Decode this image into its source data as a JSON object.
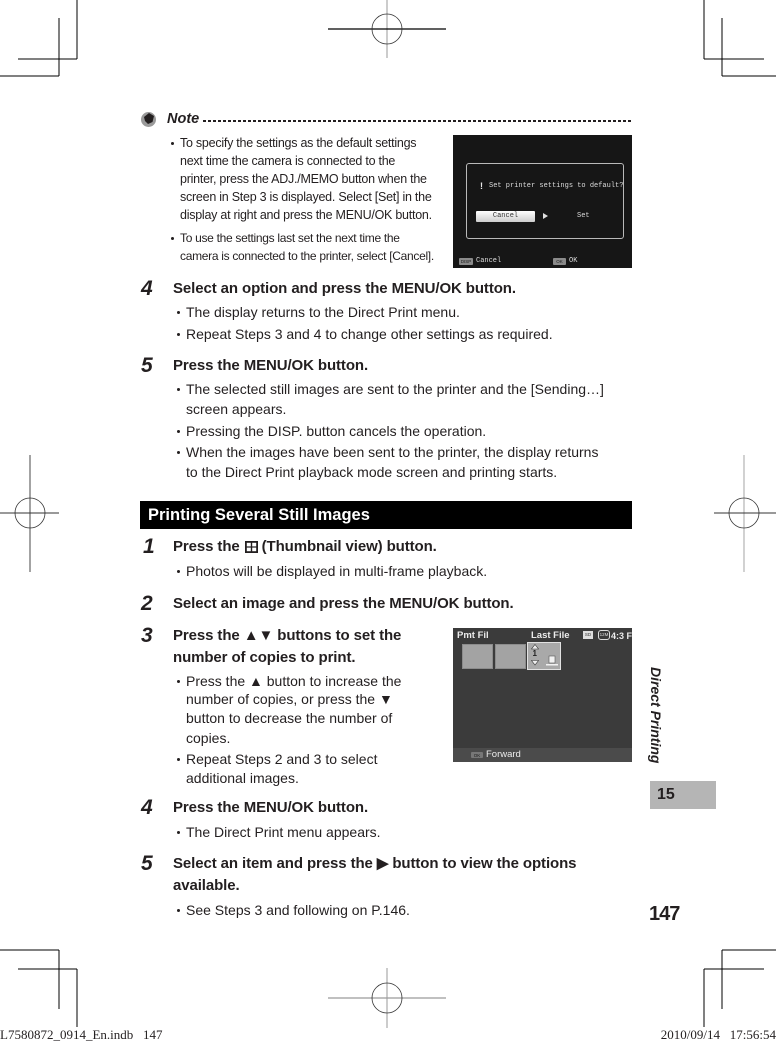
{
  "note": {
    "title": "Note",
    "icon": "note-icon",
    "bullets": [
      {
        "lines": [
          "To specify the settings as the default settings",
          "next time the camera is connected to the",
          "printer, press the ADJ./MEMO button when the",
          "screen in Step 3 is displayed. Select [Set] in the",
          "display at right and press the MENU/OK button."
        ]
      },
      {
        "lines": [
          "To use the settings last set the next time the",
          "camera is connected to the printer, select [Cancel]."
        ]
      }
    ]
  },
  "screen_default": {
    "alert": "!",
    "question": "Set printer settings to default?",
    "selected_option": "Cancel",
    "other_option": "Set",
    "footer": {
      "disp_badge": "DISP",
      "disp_label": "Cancel",
      "ok_badge": "OK",
      "ok_label": "OK"
    }
  },
  "steps_top": [
    {
      "number": "4",
      "heading": [
        "Select an option and press the MENU/OK button."
      ],
      "bullets": [
        {
          "lines": [
            "The display returns to the Direct Print menu."
          ]
        },
        {
          "lines": [
            "Repeat Steps 3 and 4 to change other settings as required."
          ]
        }
      ]
    },
    {
      "number": "5",
      "heading": [
        "Press the MENU/OK button."
      ],
      "bullets": [
        {
          "lines": [
            "The selected still images are sent to the printer and the [Sending…]",
            "screen appears."
          ]
        },
        {
          "lines": [
            "Pressing the DISP. button cancels the operation."
          ]
        },
        {
          "lines": [
            "When the images have been sent to the printer, the display returns",
            "to the Direct Print playback mode screen and printing starts."
          ]
        }
      ]
    }
  ],
  "section": {
    "title": "Printing Several Still Images"
  },
  "steps_bottom": [
    {
      "number": "1",
      "heading_before": "Press the",
      "heading_icon": "thumbnail-view-icon",
      "heading_after": "(Thumbnail view) button.",
      "bullets": [
        {
          "lines": [
            "Photos will be displayed in multi-frame playback."
          ]
        }
      ]
    },
    {
      "number": "2",
      "heading": [
        "Select an image and press the MENU/OK button."
      ]
    },
    {
      "number": "3",
      "heading": [
        "Press the ▲▼ buttons to set the",
        "number of copies to print."
      ],
      "bullets": [
        {
          "lines": [
            "Press the ▲ button to increase the",
            "number of copies, or press the ▼",
            "button to decrease the number of",
            "copies."
          ]
        },
        {
          "lines": [
            "Repeat Steps 2 and 3 to select",
            "additional images."
          ]
        }
      ]
    },
    {
      "number": "4",
      "heading": [
        "Press the MENU/OK button."
      ],
      "bullets": [
        {
          "lines": [
            "The Direct Print menu appears."
          ]
        }
      ]
    },
    {
      "number": "5",
      "heading": [
        "Select an item and press the ▶ button to view the options",
        "available."
      ],
      "bullets": [
        {
          "lines": [
            "See Steps 3 and following on P.146."
          ]
        }
      ]
    }
  ],
  "screen_thumbnails": {
    "top_left": "Pmt Fil",
    "top_center": "Last File",
    "card_icon": "SD",
    "image_size": "12M",
    "aspect_quality": "4:3 F",
    "copies": "1",
    "footer": {
      "ok_badge": "OK",
      "label": "Forward"
    }
  },
  "sidebar": {
    "chapter_title": "Direct Printing",
    "chapter_number": "15"
  },
  "page_number": "147",
  "print_footer": {
    "file_label": "L7580872_0914_En.indb   147",
    "timestamp": "2010/09/14   17:56:54"
  }
}
